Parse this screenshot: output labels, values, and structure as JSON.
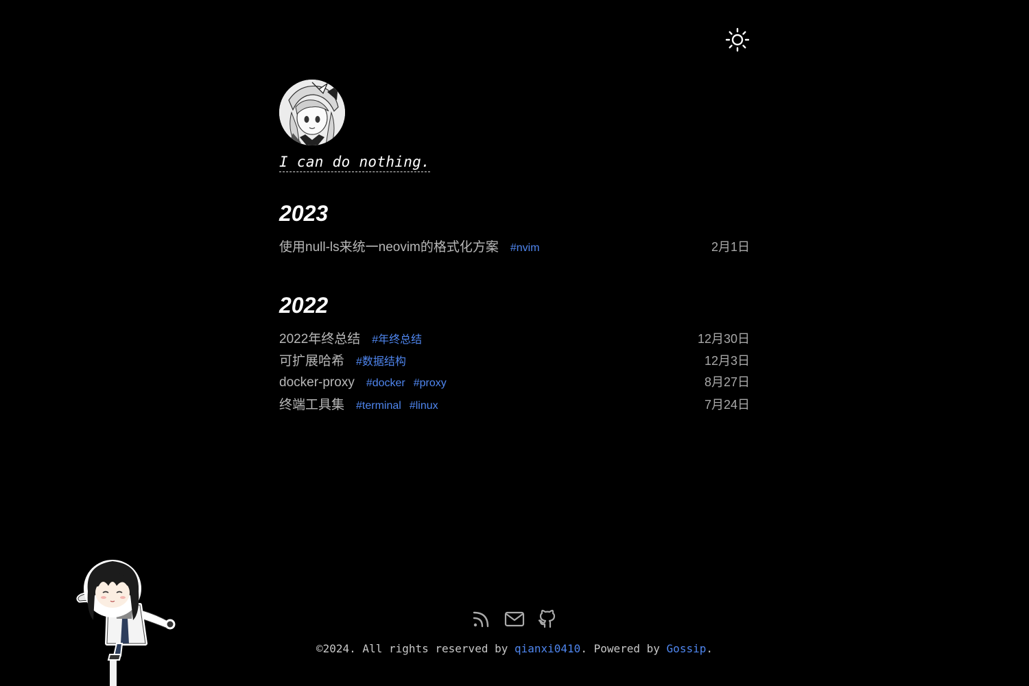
{
  "header": {
    "theme_toggle_icon": "sun-icon"
  },
  "profile": {
    "avatar_icon": "avatar-image",
    "motto": "I can do nothing."
  },
  "years": [
    {
      "year": "2023",
      "posts": [
        {
          "title": "使用null-ls来统一neovim的格式化方案",
          "tags": [
            "#nvim"
          ],
          "date": "2月1日"
        }
      ]
    },
    {
      "year": "2022",
      "posts": [
        {
          "title": "2022年终总结",
          "tags": [
            "#年终总结"
          ],
          "date": "12月30日"
        },
        {
          "title": "可扩展哈希",
          "tags": [
            "#数据结构"
          ],
          "date": "12月3日"
        },
        {
          "title": "docker-proxy",
          "tags": [
            "#docker",
            "#proxy"
          ],
          "date": "8月27日"
        },
        {
          "title": "终端工具集",
          "tags": [
            "#terminal",
            "#linux"
          ],
          "date": "7月24日"
        }
      ]
    }
  ],
  "footer": {
    "icons": [
      "rss-icon",
      "mail-icon",
      "github-icon"
    ],
    "copyright_prefix": "©2024. All rights reserved by ",
    "author": "qianxi0410",
    "middle": ". Powered by ",
    "engine": "Gossip",
    "suffix": "."
  },
  "colors": {
    "background": "#000000",
    "link": "#4f86ef",
    "post_title": "#b8b8b8",
    "date": "#a9a9a9"
  }
}
